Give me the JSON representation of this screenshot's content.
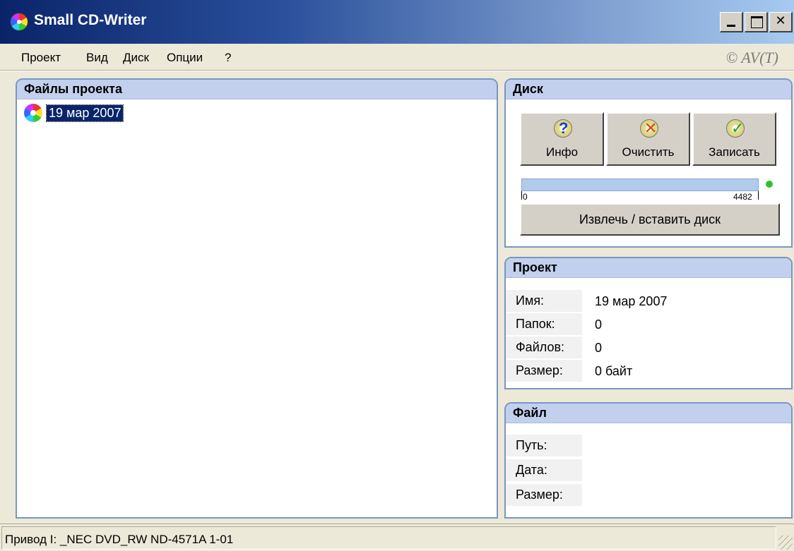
{
  "window": {
    "title": "Small CD-Writer",
    "app_icon": "cd-icon",
    "controls": {
      "minimize": "minimize-icon",
      "maximize": "maximize-icon",
      "close": "close-icon",
      "close_glyph": "✕"
    }
  },
  "menu": {
    "items": [
      "Проект",
      "Вид",
      "Диск",
      "Опции",
      "?"
    ],
    "copyright": "© AV(T)"
  },
  "files_panel": {
    "title": "Файлы проекта",
    "items": [
      {
        "label": "19 мар 2007",
        "icon": "cd-icon",
        "selected": true
      }
    ]
  },
  "disk_panel": {
    "title": "Диск",
    "buttons": [
      {
        "label": "Инфо",
        "icon": "disk-info-icon",
        "mark": "?",
        "mark_color": "#1a3fd6"
      },
      {
        "label": "Очистить",
        "icon": "disk-erase-icon",
        "mark": "✕",
        "mark_color": "#e04010"
      },
      {
        "label": "Записать",
        "icon": "disk-write-icon",
        "mark": "✓",
        "mark_color": "#2a9a2a"
      }
    ],
    "capacity": {
      "min": "0",
      "max": "4482",
      "fill_fraction": 1.0,
      "fill_color": "#b2cbea",
      "led_color": "#29c429"
    },
    "eject_label": "Извлечь / вставить диск"
  },
  "project_panel": {
    "title": "Проект",
    "rows": [
      {
        "key": "Имя:",
        "value": "19 мар 2007"
      },
      {
        "key": "Папок:",
        "value": "0"
      },
      {
        "key": "Файлов:",
        "value": "0"
      },
      {
        "key": "Размер:",
        "value": "0 байт"
      }
    ]
  },
  "file_panel": {
    "title": "Файл",
    "rows": [
      {
        "key": "Путь:",
        "value": ""
      },
      {
        "key": "Дата:",
        "value": ""
      },
      {
        "key": "Размер:",
        "value": ""
      }
    ]
  },
  "status": {
    "text": "Привод  I: _NEC DVD_RW ND-4571A 1-01"
  },
  "colors": {
    "title_gradient_start": "#0a246a",
    "title_gradient_end": "#a6caf0",
    "panel_header": "#c2d0ee",
    "panel_border": "#7896c4",
    "selection": "#0a246a"
  }
}
